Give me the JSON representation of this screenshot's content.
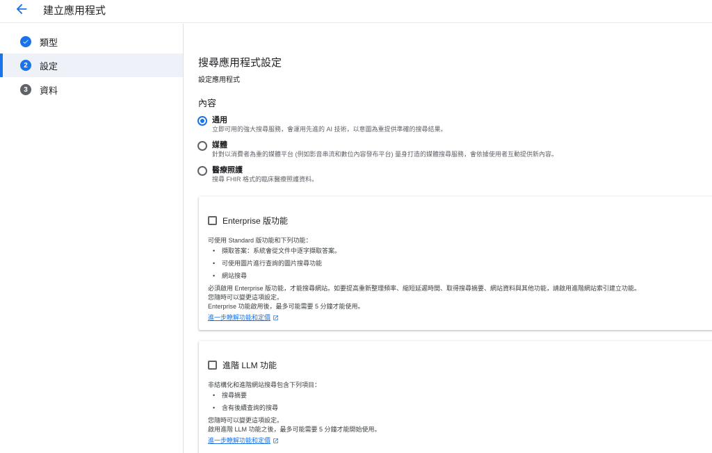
{
  "topbar": {
    "title": "建立應用程式",
    "back_icon": "arrow-back-icon"
  },
  "steps": [
    {
      "num": "✓",
      "label": "類型",
      "state": "done"
    },
    {
      "num": "2",
      "label": "設定",
      "state": "current"
    },
    {
      "num": "3",
      "label": "資料",
      "state": "todo"
    }
  ],
  "main": {
    "title": "搜尋應用程式設定",
    "subtitle": "設定應用程式",
    "content_title": "內容",
    "options": [
      {
        "label": "通用",
        "desc": "立即可用的強大搜尋服務，會運用先進的 AI 技術，以意圖為重提供準確的搜尋結果。",
        "checked": true
      },
      {
        "label": "媒體",
        "desc": "針對以消費者為重的媒體平台 (例如影音串流和數位內容發布平台) 量身打造的媒體搜尋服務，會依據使用者互動提供新內容。",
        "checked": false
      },
      {
        "label": "醫療照護",
        "desc": "搜尋 FHIR 格式的臨床醫療照護資料。",
        "checked": false
      }
    ]
  },
  "enterprise": {
    "label": "Enterprise 版功能",
    "intro": "可使用 Standard 版功能和下列功能：",
    "items": [
      "擷取答案：系統會從文件中逐字擷取答案。",
      "可使用圖片進行查詢的圖片搜尋功能",
      "網站搜尋"
    ],
    "lines": [
      "必須啟用 Enterprise 版功能，才能搜尋網站。如要提高重新整理頻率、縮短延遲時間、取得搜尋摘要、網站資料與其他功能，請啟用進階網站索引建立功能。",
      "您隨時可以變更這項設定。",
      "Enterprise 功能啟用後，最多可能需要 5 分鐘才能使用。"
    ],
    "link": "進一步瞭解功能和定價"
  },
  "llm": {
    "label": "進階 LLM 功能",
    "intro": "非結構化和進階網站搜尋包含下列項目：",
    "items": [
      "搜尋摘要",
      "含有後續查詢的搜尋"
    ],
    "lines": [
      "您隨時可以變更這項設定。",
      "啟用進階 LLM 功能之後，最多可能需要 5 分鐘才能開始使用。"
    ],
    "link": "進一步瞭解功能和定價"
  },
  "colors": {
    "accent": "#1a73e8",
    "text": "#202124",
    "secondary": "#5f6368",
    "active_step_bg": "#eef1f8"
  }
}
